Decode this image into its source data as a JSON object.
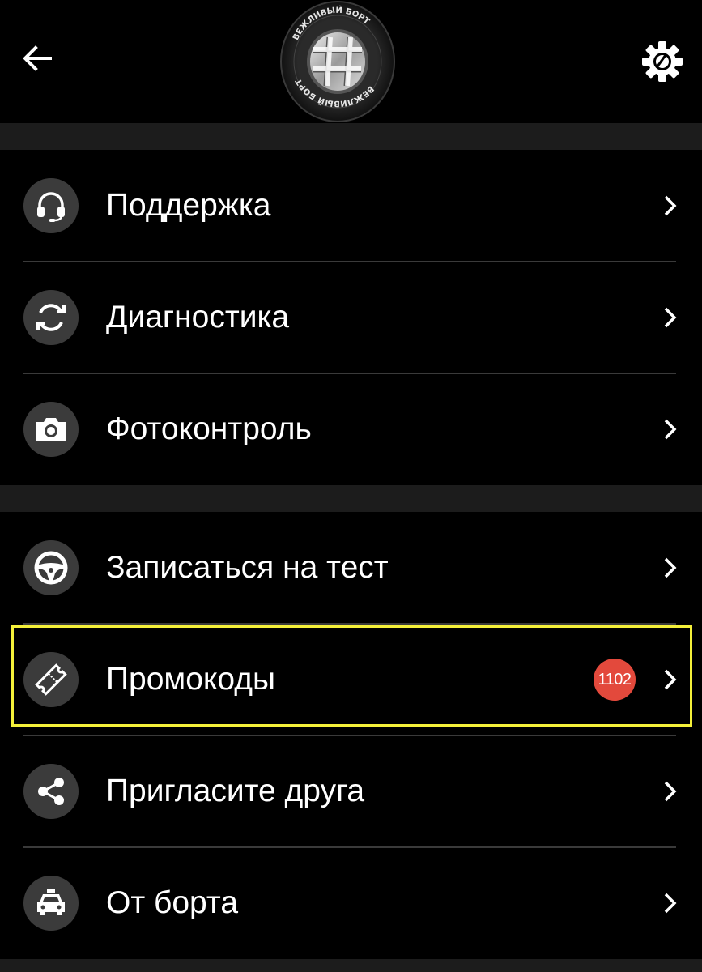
{
  "header": {
    "back_icon": "arrow-left-icon",
    "settings_icon": "gear-icon",
    "logo_text": "ВЕЖЛИВЫЙ БОРТ"
  },
  "menu_group_1": [
    {
      "label": "Поддержка",
      "icon": "headset-icon"
    },
    {
      "label": "Диагностика",
      "icon": "refresh-icon"
    },
    {
      "label": "Фотоконтроль",
      "icon": "camera-icon"
    }
  ],
  "menu_group_2": [
    {
      "label": "Записаться на тест",
      "icon": "steering-wheel-icon"
    },
    {
      "label": "Промокоды",
      "icon": "ticket-icon",
      "badge": "1102"
    },
    {
      "label": "Пригласите друга",
      "icon": "share-icon"
    },
    {
      "label": "От борта",
      "icon": "taxi-icon"
    }
  ],
  "colors": {
    "background": "#000000",
    "separator": "#1c1c1c",
    "icon_circle": "#3b3b3b",
    "badge": "#e3493c",
    "highlight": "#f4f03a"
  }
}
